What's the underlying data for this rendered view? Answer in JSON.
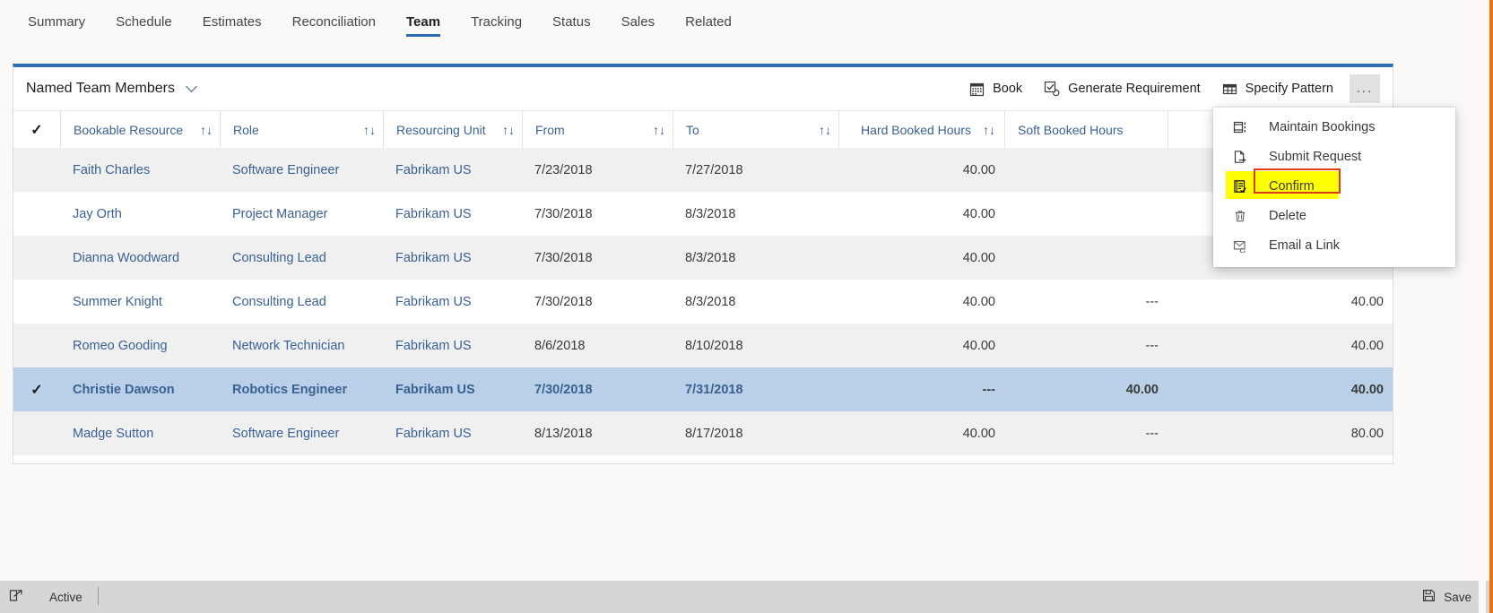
{
  "tabs": [
    {
      "label": "Summary",
      "active": false
    },
    {
      "label": "Schedule",
      "active": false
    },
    {
      "label": "Estimates",
      "active": false
    },
    {
      "label": "Reconciliation",
      "active": false
    },
    {
      "label": "Team",
      "active": true
    },
    {
      "label": "Tracking",
      "active": false
    },
    {
      "label": "Status",
      "active": false
    },
    {
      "label": "Sales",
      "active": false
    },
    {
      "label": "Related",
      "active": false
    }
  ],
  "panel": {
    "view_title": "Named Team Members",
    "commands": [
      {
        "label": "Book",
        "icon": "calendar-icon"
      },
      {
        "label": "Generate Requirement",
        "icon": "checkbox-refresh-icon"
      },
      {
        "label": "Specify Pattern",
        "icon": "grid-icon"
      }
    ],
    "overflow_label": "..."
  },
  "grid": {
    "columns": [
      {
        "label": "Bookable Resource",
        "sortable": true,
        "align": "left"
      },
      {
        "label": "Role",
        "sortable": true,
        "align": "left"
      },
      {
        "label": "Resourcing Unit",
        "sortable": true,
        "align": "left"
      },
      {
        "label": "From",
        "sortable": true,
        "align": "left"
      },
      {
        "label": "To",
        "sortable": true,
        "align": "left"
      },
      {
        "label": "Hard Booked Hours",
        "sortable": true,
        "align": "right"
      },
      {
        "label": "Soft Booked Hours",
        "sortable": false,
        "align": "right"
      },
      {
        "label": "",
        "sortable": false,
        "align": "right"
      }
    ],
    "sort_glyph": "↑↓",
    "header_check": "✓",
    "row_check": "✓",
    "rows": [
      {
        "selected": false,
        "resource": "Faith Charles",
        "role": "Software Engineer",
        "unit": "Fabrikam US",
        "from": "7/23/2018",
        "to": "7/27/2018",
        "hard": "40.00",
        "soft": "",
        "total": ""
      },
      {
        "selected": false,
        "resource": "Jay Orth",
        "role": "Project Manager",
        "unit": "Fabrikam US",
        "from": "7/30/2018",
        "to": "8/3/2018",
        "hard": "40.00",
        "soft": "",
        "total": ""
      },
      {
        "selected": false,
        "resource": "Dianna Woodward",
        "role": "Consulting Lead",
        "unit": "Fabrikam US",
        "from": "7/30/2018",
        "to": "8/3/2018",
        "hard": "40.00",
        "soft": "",
        "total": ""
      },
      {
        "selected": false,
        "resource": "Summer Knight",
        "role": "Consulting Lead",
        "unit": "Fabrikam US",
        "from": "7/30/2018",
        "to": "8/3/2018",
        "hard": "40.00",
        "soft": "---",
        "total": "40.00"
      },
      {
        "selected": false,
        "resource": "Romeo Gooding",
        "role": "Network Technician",
        "unit": "Fabrikam US",
        "from": "8/6/2018",
        "to": "8/10/2018",
        "hard": "40.00",
        "soft": "---",
        "total": "40.00"
      },
      {
        "selected": true,
        "resource": "Christie Dawson",
        "role": "Robotics Engineer",
        "unit": "Fabrikam US",
        "from": "7/30/2018",
        "to": "7/31/2018",
        "hard": "---",
        "soft": "40.00",
        "total": "40.00"
      },
      {
        "selected": false,
        "resource": "Madge Sutton",
        "role": "Software Engineer",
        "unit": "Fabrikam US",
        "from": "8/13/2018",
        "to": "8/17/2018",
        "hard": "40.00",
        "soft": "---",
        "total": "80.00"
      }
    ]
  },
  "menu": {
    "items": [
      {
        "label": "Maintain Bookings",
        "icon": "maintain-bookings-icon",
        "highlighted": false
      },
      {
        "label": "Submit Request",
        "icon": "submit-request-icon",
        "highlighted": false
      },
      {
        "label": "Confirm",
        "icon": "confirm-icon",
        "highlighted": true
      },
      {
        "label": "Delete",
        "icon": "trash-icon",
        "highlighted": false
      },
      {
        "label": "Email a Link",
        "icon": "email-link-icon",
        "highlighted": false
      }
    ]
  },
  "statusbar": {
    "status": "Active",
    "save_label": "Save"
  },
  "colors": {
    "accent": "#2b6cb5",
    "link": "#3b6192",
    "selected_row": "#b9d0e8",
    "alt_row": "#f0f0f0",
    "highlight": "#ffff00",
    "annotation": "#e03a17",
    "page_border": "#e8730c"
  }
}
